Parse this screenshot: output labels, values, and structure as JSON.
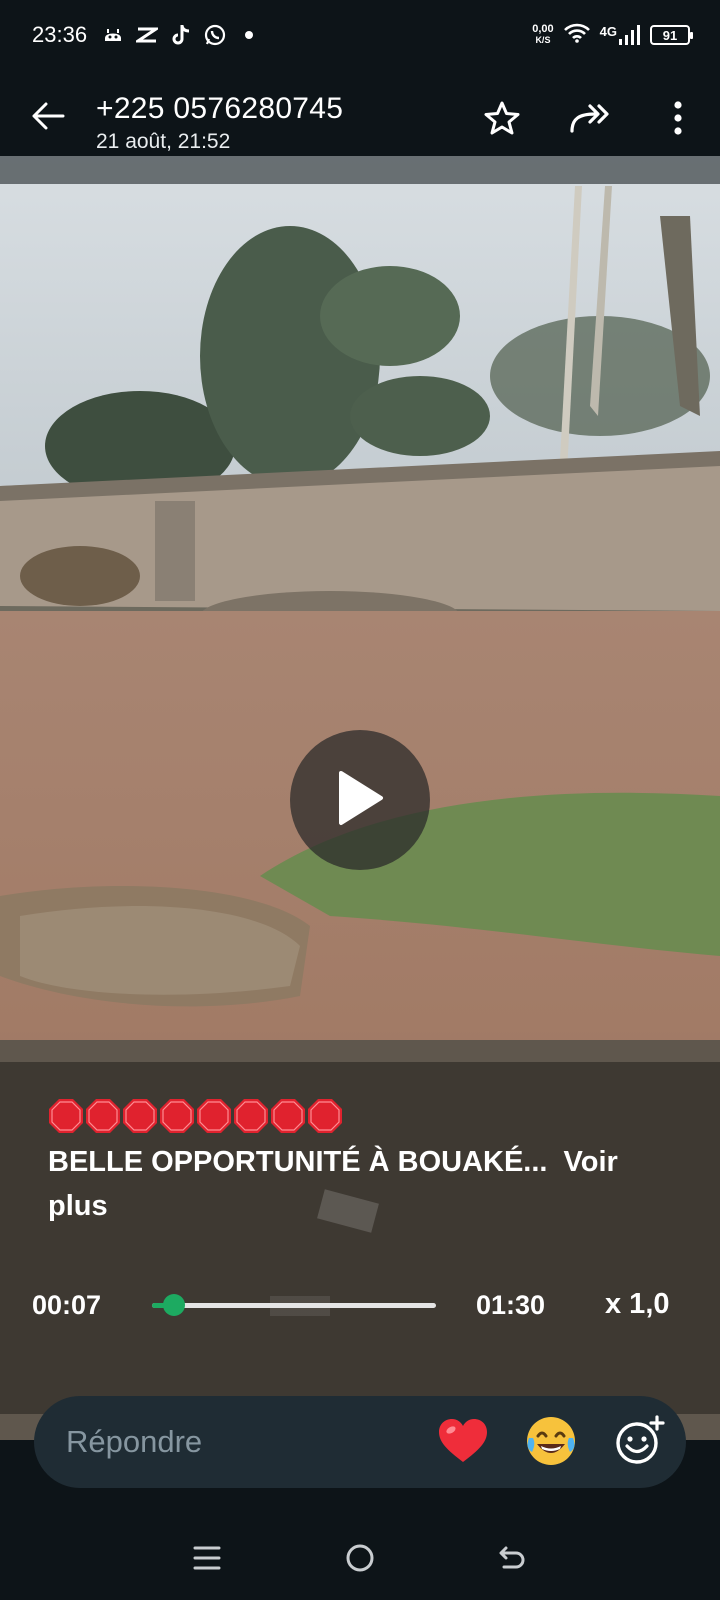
{
  "status_bar": {
    "time": "23:36",
    "notification_icons": [
      "android-robot-icon",
      "capcut-icon",
      "tiktok-icon",
      "whatsapp-icon",
      "dot-icon"
    ],
    "net_speed_value": "0,00",
    "net_speed_unit": "K/S",
    "network_type": "4G",
    "battery_level": "91"
  },
  "header": {
    "contact": "+225 0576280745",
    "timestamp": "21 août, 21:52",
    "icons": [
      "back-arrow-icon",
      "star-icon",
      "forward-icon",
      "more-vert-icon"
    ]
  },
  "video": {
    "caption_main": "BELLE OPPORTUNITÉ À BOUAKÉ...",
    "caption_more": "Voir plus",
    "stop_emoji_count": 8,
    "current_time": "00:07",
    "total_time": "01:30",
    "playback_speed": "x 1,0",
    "progress_fraction": 0.078
  },
  "reply": {
    "placeholder": "Répondre",
    "quick_reactions": [
      "heart-emoji",
      "laughing-tears-emoji",
      "add-emoji-icon"
    ]
  },
  "nav": {
    "icons": [
      "menu-icon",
      "home-icon",
      "back-icon"
    ]
  },
  "colors": {
    "accent_green": "#1daa61",
    "app_bg": "#0d1418",
    "reply_bg": "#1f2c34"
  }
}
